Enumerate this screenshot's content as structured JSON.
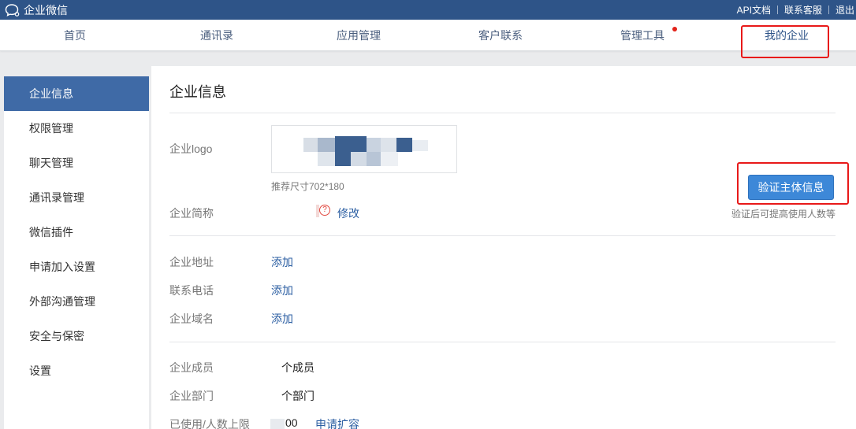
{
  "topbar": {
    "brand": "企业微信",
    "links": [
      "API文档",
      "联系客服",
      "退出"
    ]
  },
  "nav": {
    "items": [
      "首页",
      "通讯录",
      "应用管理",
      "客户联系",
      "管理工具",
      "我的企业"
    ],
    "active_index": 5,
    "notification_dot_index": 4
  },
  "sidebar": {
    "items": [
      "企业信息",
      "权限管理",
      "聊天管理",
      "通讯录管理",
      "微信插件",
      "申请加入设置",
      "外部沟通管理",
      "安全与保密",
      "设置"
    ],
    "active_index": 0
  },
  "content": {
    "title": "企业信息",
    "logo": {
      "label": "企业logo",
      "hint": "推荐尺寸702*180"
    },
    "short_name": {
      "label": "企业简称",
      "edit": "修改"
    },
    "verify": {
      "button": "验证主体信息",
      "hint": "验证后可提高使用人数等"
    },
    "address": {
      "label": "企业地址",
      "action": "添加"
    },
    "phone": {
      "label": "联系电话",
      "action": "添加"
    },
    "domain": {
      "label": "企业域名",
      "action": "添加"
    },
    "members": {
      "label": "企业成员",
      "value": "个成员"
    },
    "departments": {
      "label": "企业部门",
      "value": "个部门"
    },
    "limit": {
      "label": "已使用/人数上限",
      "value": "00",
      "action": "申请扩容"
    }
  },
  "colors": {
    "topbar": "#2e5488",
    "accent": "#3f6aa6",
    "button": "#3d88d8",
    "link": "#2b5ea2",
    "highlight": "#e81919"
  }
}
